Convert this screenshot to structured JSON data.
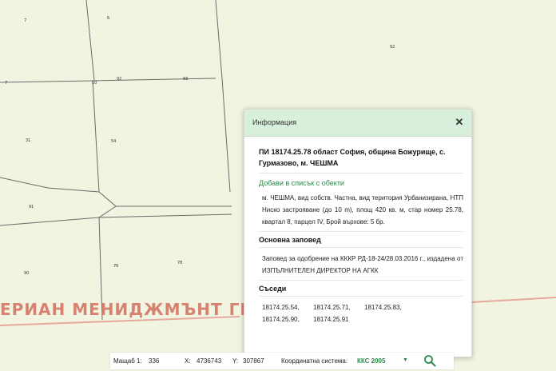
{
  "map": {
    "parcel_numbers": [
      "7",
      "6",
      "92",
      "7",
      "10",
      "92",
      "93",
      "31",
      "54",
      "91",
      "90",
      "76",
      "78"
    ],
    "watermark": "ЕРИАН МЕНИДЖМЪНТ ГРУП"
  },
  "info_panel": {
    "title": "Информация",
    "parcel_title": "ПИ 18174.25.78 област София, община Божурище, с. Гурмазово, м. ЧЕШМА",
    "add_link": "Добави в списък с обекти",
    "description": "м. ЧЕШМА, вид собств. Частна, вид територия Урбанизирана, НТП Ниско застрояване (до 10 m), площ 420 кв. м, стар номер 25.78, квартал 8, парцел IV, Брой върхове: 5 бр.",
    "order_heading": "Основна заповед",
    "order_text": "Заповед за одобрение на КККР РД-18-24/28.03.2016 г., издадена от ИЗПЪЛНИТЕЛЕН ДИРЕКТОР НА АГКК",
    "neighbors_heading": "Съседи",
    "neighbors": [
      "18174.25.54,",
      "18174.25.71,",
      "18174.25.83,",
      "18174.25.90,",
      "18174.25.91"
    ]
  },
  "statusbar": {
    "scale_label": "Мащаб 1:",
    "scale_value": "336",
    "x_label": "X:",
    "x_value": "4736743",
    "y_label": "Y:",
    "y_value": "307867",
    "crs_label": "Координатна система:",
    "crs_value": "ККС 2005"
  },
  "colors": {
    "map_background": "#f1f4e1",
    "parcel_lines": "#6b6b6b",
    "cadastre_border": "#e6a89c",
    "watermark": "#d57564",
    "panel_header": "#d8f0db",
    "accent_green": "#2a8a4a"
  }
}
